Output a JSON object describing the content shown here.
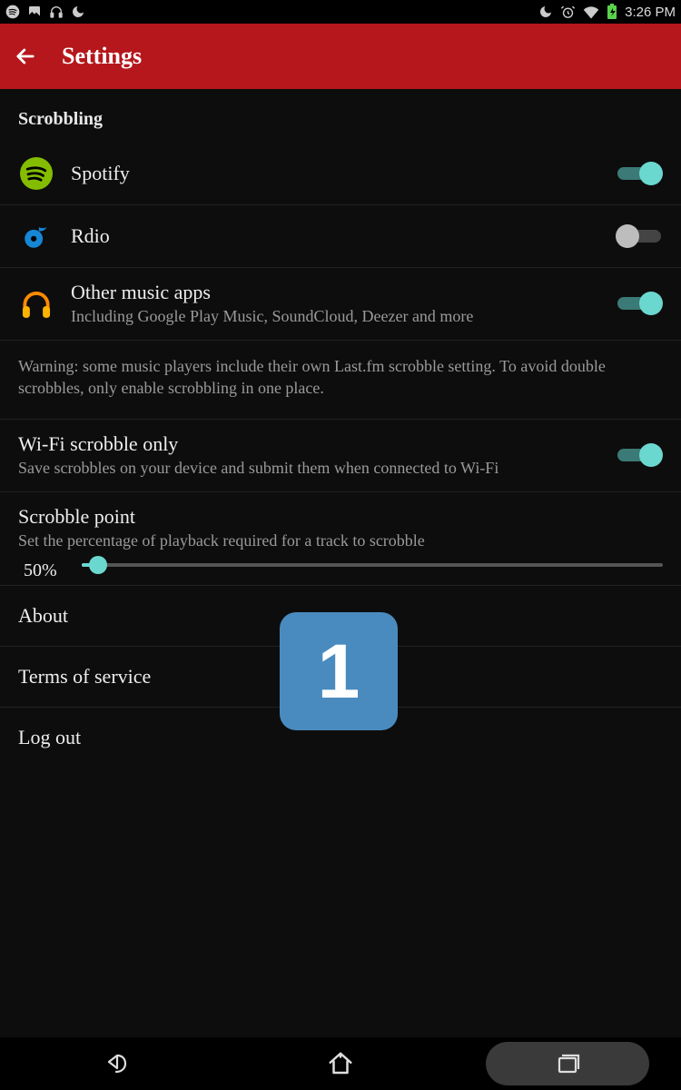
{
  "status": {
    "time": "3:26 PM"
  },
  "appbar": {
    "title": "Settings"
  },
  "section": {
    "header": "Scrobbling"
  },
  "rows": {
    "spotify": {
      "label": "Spotify",
      "toggle_on": true
    },
    "rdio": {
      "label": "Rdio",
      "toggle_on": false
    },
    "other": {
      "label": "Other music apps",
      "sub": "Including Google Play Music, SoundCloud, Deezer and more",
      "toggle_on": true
    },
    "warning": "Warning: some music players include their own Last.fm scrobble setting. To avoid double scrobbles, only enable scrobbling in one place.",
    "wifi": {
      "label": "Wi-Fi scrobble only",
      "sub": "Save scrobbles on your device and submit them when connected to Wi-Fi",
      "toggle_on": true
    },
    "scrobble_point": {
      "label": "Scrobble point",
      "sub": "Set the percentage of playback required for a track to scrobble",
      "value_label": "50%",
      "value_percent": 50
    },
    "about": "About",
    "terms": "Terms of service",
    "logout": "Log out"
  },
  "overlay": {
    "badge": "1"
  },
  "colors": {
    "accent": "#6bd8d0",
    "brand": "#b5171c",
    "overlay": "#4a8bbf"
  }
}
